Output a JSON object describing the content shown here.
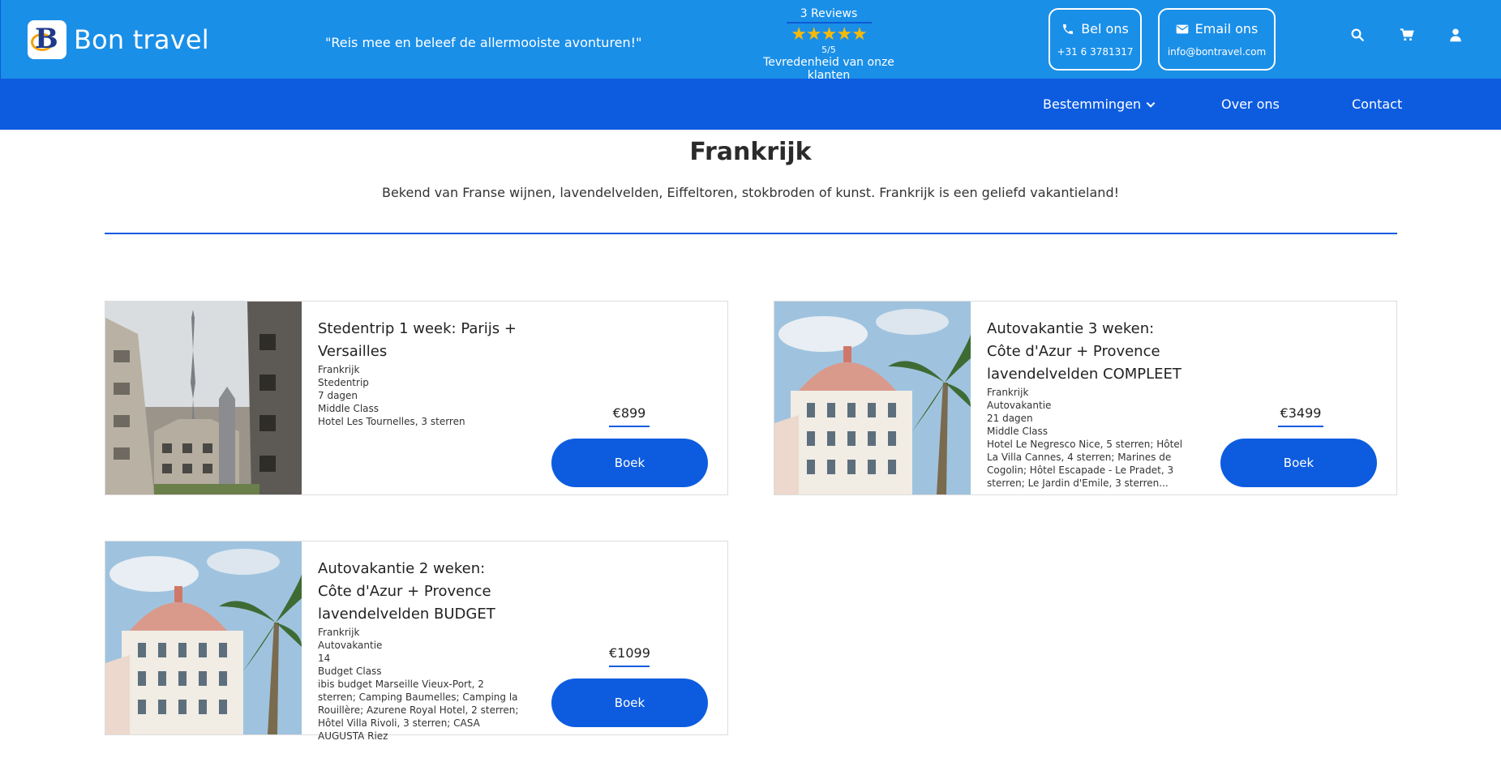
{
  "header": {
    "brand": "Bon travel",
    "slogan": "\"Reis mee en beleef de allermooiste avonturen!\"",
    "reviews": {
      "count_label": "3 Reviews",
      "stars": "★★★★★",
      "score": "5/5",
      "satisfaction": "Tevredenheid van onze klanten"
    },
    "call": {
      "label": "Bel ons",
      "value": "+31 6 3781317"
    },
    "email": {
      "label": "Email ons",
      "value": "info@bontravel.com"
    },
    "icons": [
      "search-icon",
      "cart-icon",
      "user-icon"
    ]
  },
  "nav": {
    "items": [
      {
        "label": "Bestemmingen"
      },
      {
        "label": "Over ons"
      },
      {
        "label": "Contact"
      }
    ]
  },
  "main": {
    "title": "Frankrijk",
    "intro": "Bekend van Franse wijnen, lavendelvelden, Eiffeltoren, stokbroden of kunst. Frankrijk is een geliefd vakantieland!"
  },
  "trips": [
    {
      "title": "Stedentrip 1 week: Parijs + Versailles",
      "country": "Frankrijk",
      "type": "Stedentrip",
      "duration": "7 dagen",
      "class": "Middle Class",
      "hotels": "Hotel Les Tournelles, 3 sterren",
      "price": "€899",
      "button": "Boek",
      "image": "paris-street-eiffel-tower-photo"
    },
    {
      "title": "Autovakantie 3 weken: Côte d'Azur + Provence lavendelvelden COMPLEET",
      "country": "Frankrijk",
      "type": "Autovakantie",
      "duration": "21 dagen",
      "class": "Middle Class",
      "hotels": "Hotel Le Negresco Nice, 5 sterren; Hôtel La Villa Cannes, 4 sterren; Marines de Cogolin; Hôtel Escapade - Le Pradet, 3 sterren; Le Jardin d'Emile, 3 sterren...",
      "price": "€3499",
      "button": "Boek",
      "image": "nice-hotel-palm-photo"
    },
    {
      "title": "Autovakantie 2 weken: Côte d'Azur + Provence lavendelvelden BUDGET",
      "country": "Frankrijk",
      "type": "Autovakantie",
      "duration": "14",
      "class": "Budget Class",
      "hotels": "ibis budget Marseille Vieux-Port, 2 sterren; Camping Baumelles; Camping la Rouillère; Azurene Royal Hotel, 2 sterren; Hôtel Villa Rivoli, 3 sterren; CASA AUGUSTA Riez",
      "price": "€1099",
      "button": "Boek",
      "image": "nice-hotel-palm-photo"
    }
  ],
  "colors": {
    "topbar": "#1a8fe8",
    "nav": "#0d5ce0",
    "accent": "#0d5ce0",
    "stars": "#f6b90b"
  }
}
